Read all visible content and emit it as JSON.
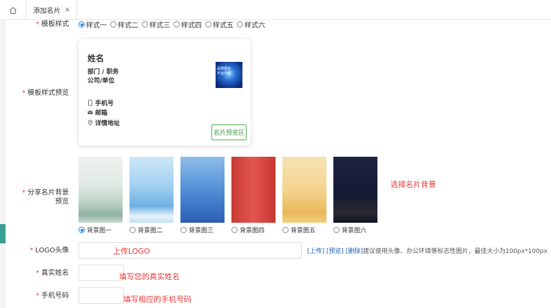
{
  "tabs": {
    "active": "添加名片",
    "close": "×"
  },
  "form": {
    "template_style": {
      "label": "模板样式",
      "options": [
        "样式一",
        "样式二",
        "样式三",
        "样式四",
        "样式五",
        "样式六"
      ],
      "selected": "样式一"
    },
    "template_preview": {
      "label": "模板样式预览",
      "card": {
        "name": "姓名",
        "department": "部门 / 职务",
        "company": "公司/单位",
        "phone": "手机号",
        "email": "邮箱",
        "address": "详情地址",
        "thumb_text": "品牌展示\n平台介绍",
        "preview_button": "名片预览区"
      }
    },
    "share_background": {
      "label_line1": "分享名片背景",
      "label_line2": "预览",
      "hint": "选择名片背景",
      "options": [
        "背景图一",
        "背景图二",
        "背景图三",
        "背景图四",
        "背景图五",
        "背景图六"
      ],
      "selected": "背景图一"
    },
    "logo": {
      "label": "LOGO头像",
      "hint": "上传LOGO",
      "upload": "[上传]",
      "preview": "[预览]",
      "delete": "[删除]",
      "note": "建议使用头像、办公环境等标志性图片，最佳大小为100px*100px"
    },
    "real_name": {
      "label": "真实姓名",
      "hint": "填写您的真实姓名"
    },
    "phone": {
      "label": "手机号码",
      "hint": "填写相应的手机号码"
    }
  },
  "colors": {
    "accent": "#1e7fe0",
    "required": "#ff3333",
    "hint": "#e53935",
    "preview_button": "#4caf50"
  },
  "required_mark": "*"
}
